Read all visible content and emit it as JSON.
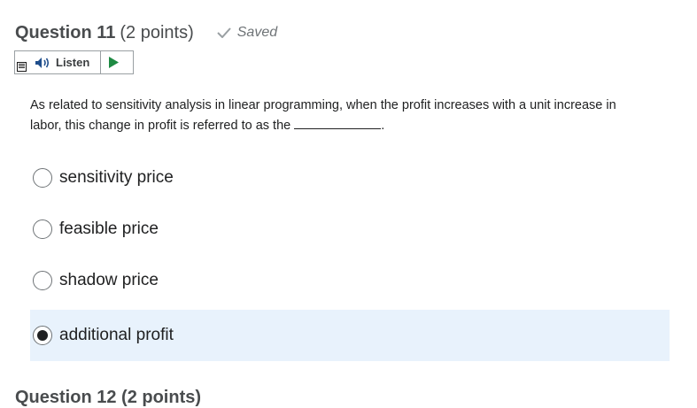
{
  "question": {
    "title": "Question 11",
    "points": "(2 points)",
    "status": "Saved",
    "prompt_text": "As related to sensitivity analysis in linear programming, when the profit increases with a unit increase in labor, this change in profit is referred to as the",
    "prompt_end": "."
  },
  "listen": {
    "label": "Listen"
  },
  "options": [
    {
      "label": "sensitivity price",
      "selected": false
    },
    {
      "label": "feasible price",
      "selected": false
    },
    {
      "label": "shadow price",
      "selected": false
    },
    {
      "label": "additional profit",
      "selected": true
    }
  ],
  "next_question": {
    "title": "Question 12 (2 points)"
  }
}
